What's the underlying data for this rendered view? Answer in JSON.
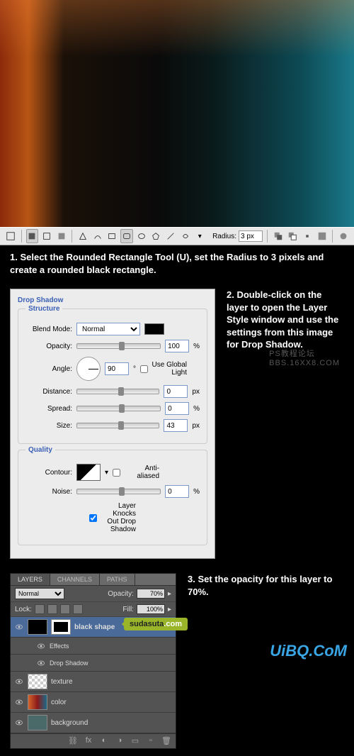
{
  "toolbar": {
    "radius_label": "Radius:",
    "radius_value": "3 px"
  },
  "step1": "1. Select the Rounded Rectangle Tool (U), set the Radius to 3 pixels and create a rounded black rectangle.",
  "drop_shadow": {
    "title": "Drop Shadow",
    "structure": "Structure",
    "blend_mode_label": "Blend Mode:",
    "blend_mode_value": "Normal",
    "opacity_label": "Opacity:",
    "opacity_value": "100",
    "percent": "%",
    "angle_label": "Angle:",
    "angle_value": "90",
    "degree": "°",
    "global_light": "Use Global Light",
    "distance_label": "Distance:",
    "distance_value": "0",
    "px": "px",
    "spread_label": "Spread:",
    "spread_value": "0",
    "size_label": "Size:",
    "size_value": "43",
    "quality": "Quality",
    "contour_label": "Contour:",
    "anti_aliased": "Anti-aliased",
    "noise_label": "Noise:",
    "noise_value": "0",
    "knocks_out": "Layer Knocks Out Drop Shadow"
  },
  "step2": "2. Double-click on the layer to open the Layer Style window and use the settings from this image for Drop Shadow.",
  "watermark1": "PS教程论坛",
  "watermark2": "BBS.16XX8.COM",
  "layers": {
    "tab1": "LAYERS",
    "tab2": "CHANNELS",
    "tab3": "PATHS",
    "blend_value": "Normal",
    "opacity_label": "Opacity:",
    "opacity_value": "70%",
    "lock_label": "Lock:",
    "fill_label": "Fill:",
    "fill_value": "100%",
    "items": [
      {
        "name": "black shape",
        "fx": "fx"
      },
      {
        "name": "Effects"
      },
      {
        "name": "Drop Shadow"
      },
      {
        "name": "texture"
      },
      {
        "name": "color"
      },
      {
        "name": "background"
      }
    ]
  },
  "step3": "3. Set the opacity for this layer to 70%.",
  "suda": "sudasuta",
  "suda_ext": ".com",
  "uibq": "UiBQ.CoM"
}
